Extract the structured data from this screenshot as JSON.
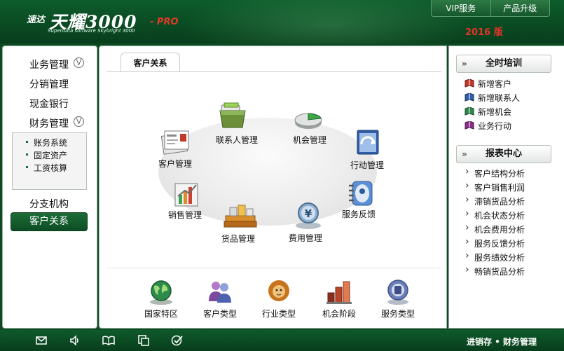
{
  "header": {
    "logo_prefix": "速达",
    "logo_main": "天耀3000",
    "logo_pro": "- PRO",
    "logo_sub": "Superdata software Skybright 3000",
    "vip_label": "VIP服务",
    "upgrade_label": "产品升级",
    "version": "2016 版"
  },
  "left_nav": {
    "items": [
      "业务管理",
      "分销管理",
      "现金银行",
      "财务管理",
      "分支机构"
    ],
    "sub_items": [
      "账务系统",
      "固定资产",
      "工资核算"
    ],
    "active": "客户关系"
  },
  "center": {
    "tab": "客户关系",
    "modules": [
      "联系人管理",
      "机会管理",
      "客户管理",
      "行动管理",
      "销售管理",
      "服务反馈",
      "货品管理",
      "费用管理"
    ],
    "categories": [
      "国家特区",
      "客户类型",
      "行业类型",
      "机会阶段",
      "服务类型"
    ]
  },
  "right": {
    "training_title": "全时培训",
    "training_items": [
      "新增客户",
      "新增联系人",
      "新增机会",
      "业务行动"
    ],
    "report_title": "报表中心",
    "report_items": [
      "客户结构分析",
      "客户销售利润",
      "滞销货品分析",
      "机会状态分析",
      "机会费用分析",
      "服务反馈分析",
      "服务绩效分析",
      "畅销货品分析"
    ]
  },
  "footer": {
    "brand": "进销存 • 财务管理"
  },
  "colors": {
    "header_green": "#0a4a22",
    "accent_red": "#e03a2a",
    "active_green": "#1d6d38"
  }
}
